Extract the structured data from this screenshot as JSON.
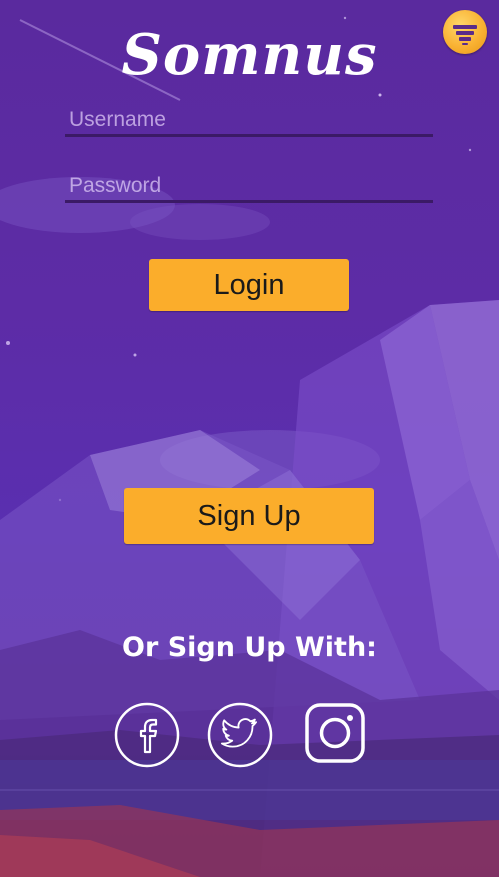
{
  "app": {
    "logo_text": "Somnus"
  },
  "menu": {
    "icon": "menu-icon"
  },
  "login_form": {
    "username_placeholder": "Username",
    "password_placeholder": "Password",
    "username_value": "",
    "password_value": "",
    "login_label": "Login"
  },
  "signup": {
    "label": "Sign Up"
  },
  "social": {
    "heading": "Or Sign Up With:",
    "providers": [
      {
        "name": "facebook",
        "icon": "facebook-icon"
      },
      {
        "name": "twitter",
        "icon": "twitter-icon"
      },
      {
        "name": "instagram",
        "icon": "instagram-icon"
      }
    ]
  },
  "colors": {
    "button": "#fbad2b",
    "background": "#5d2ca6",
    "field_underline": "#3b1a66",
    "text_light": "#ffffff"
  }
}
